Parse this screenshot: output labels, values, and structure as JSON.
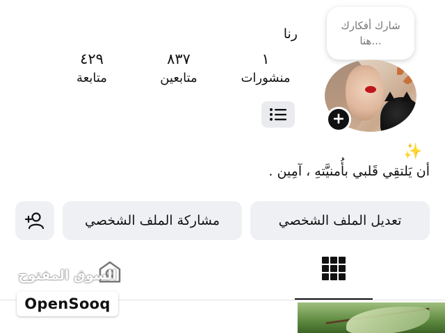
{
  "note": {
    "line1": "شارك أفكارك",
    "line2": "هنا..."
  },
  "profile": {
    "name": "رنا"
  },
  "stats": [
    {
      "value": "١",
      "label": "منشورات"
    },
    {
      "value": "٨٣٧",
      "label": "متابعين"
    },
    {
      "value": "٤٢٩",
      "label": "متابعة"
    }
  ],
  "bio": {
    "emoji": "✨",
    "text": "أن يَلتقِي قَلبي بأُمنيَّتهِ ، آمِين ."
  },
  "buttons": {
    "edit_profile": "تعديل الملف الشخصي",
    "share_profile": "مشاركة الملف الشخصي"
  },
  "watermark": {
    "arabic": "السوق المفتوح",
    "brand": "OpenSooq"
  },
  "icons": {
    "add_story": "plus-icon",
    "menu": "list-icon",
    "add_person": "add-person-icon",
    "grid": "grid-icon"
  }
}
